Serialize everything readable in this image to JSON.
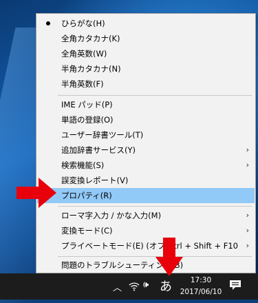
{
  "menu": {
    "items": [
      {
        "label": "ひらがな(H)",
        "checked": true,
        "shortcut": "",
        "submenu": false,
        "highlight": false
      },
      {
        "label": "全角カタカナ(K)",
        "checked": false,
        "shortcut": "",
        "submenu": false,
        "highlight": false
      },
      {
        "label": "全角英数(W)",
        "checked": false,
        "shortcut": "",
        "submenu": false,
        "highlight": false
      },
      {
        "label": "半角カタカナ(N)",
        "checked": false,
        "shortcut": "",
        "submenu": false,
        "highlight": false
      },
      {
        "label": "半角英数(F)",
        "checked": false,
        "shortcut": "",
        "submenu": false,
        "highlight": false
      },
      {
        "label": "IME パッド(P)",
        "checked": false,
        "shortcut": "",
        "submenu": false,
        "highlight": false
      },
      {
        "label": "単語の登録(O)",
        "checked": false,
        "shortcut": "",
        "submenu": false,
        "highlight": false
      },
      {
        "label": "ユーザー辞書ツール(T)",
        "checked": false,
        "shortcut": "",
        "submenu": false,
        "highlight": false
      },
      {
        "label": "追加辞書サービス(Y)",
        "checked": false,
        "shortcut": "",
        "submenu": true,
        "highlight": false
      },
      {
        "label": "検索機能(S)",
        "checked": false,
        "shortcut": "",
        "submenu": true,
        "highlight": false
      },
      {
        "label": "誤変換レポート(V)",
        "checked": false,
        "shortcut": "",
        "submenu": false,
        "highlight": false
      },
      {
        "label": "プロパティ(R)",
        "checked": false,
        "shortcut": "",
        "submenu": false,
        "highlight": true
      },
      {
        "label": "ローマ字入力 / かな入力(M)",
        "checked": false,
        "shortcut": "",
        "submenu": true,
        "highlight": false
      },
      {
        "label": "変換モード(C)",
        "checked": false,
        "shortcut": "",
        "submenu": true,
        "highlight": false
      },
      {
        "label": "プライベートモード(E) (オフ)",
        "checked": false,
        "shortcut": "Ctrl + Shift + F10",
        "submenu": true,
        "highlight": false
      },
      {
        "label": "問題のトラブルシューティング(B)",
        "checked": false,
        "shortcut": "",
        "submenu": false,
        "highlight": false
      }
    ],
    "submenu_glyph": "›",
    "highlight_color": "#91c9f7"
  },
  "taskbar": {
    "chevron_glyph": "︿",
    "volume_glyph": "🕪",
    "ime_indicator": "あ",
    "time": "17:30",
    "date": "2017/06/10"
  },
  "annotation_color": "#e8000b"
}
